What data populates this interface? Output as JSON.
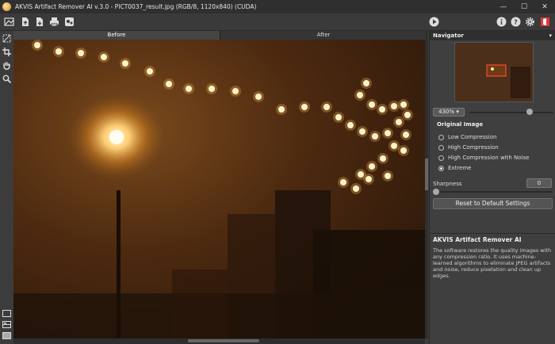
{
  "window": {
    "title": "AKVIS Artifact Remover AI v.3.0 - PICT0037_result.jpg (RGB/8, 1120x840) (CUDA)",
    "minimize": "—",
    "maximize": "☐",
    "close": "✕"
  },
  "tabs": [
    {
      "label": "Before",
      "active": true
    },
    {
      "label": "After",
      "active": false
    }
  ],
  "navigator": {
    "title": "Navigator",
    "menu_glyph": "▾",
    "zoom": "430%",
    "zoom_arrow": "▾",
    "zoom_level": 0.72
  },
  "original_image": {
    "title": "Original Image",
    "options": [
      {
        "label": "Low Compression",
        "checked": false
      },
      {
        "label": "High Compression",
        "checked": false
      },
      {
        "label": "High Compression with Noise",
        "checked": false
      },
      {
        "label": "Extreme",
        "checked": true
      }
    ]
  },
  "sharpness": {
    "label": "Sharpness",
    "value": "0"
  },
  "reset_label": "Reset to Default Settings",
  "info": {
    "title": "AKVIS Artifact Remover AI",
    "text": "The software restores the quality images with any compression ratio. It uses machine-learned algorithms to eliminate JPEG artifacts and noise, reduce pixelation and clean up edges."
  },
  "icons": {
    "toolbar_left": [
      "home-icon",
      "open-file-icon",
      "save-file-icon",
      "print-icon",
      "batch-icon"
    ],
    "toolbar_right": [
      "run-icon",
      "info-icon",
      "help-icon",
      "settings-icon",
      "exit-icon"
    ],
    "left_tools": [
      "compare-icon",
      "crop-icon",
      "hand-icon",
      "zoom-icon"
    ]
  },
  "colors": {
    "accent_red": "#e03a3a",
    "light_glow": "#fff2b8",
    "bulb": "#ffe9b0",
    "canvas_bg": "#2a150a"
  }
}
